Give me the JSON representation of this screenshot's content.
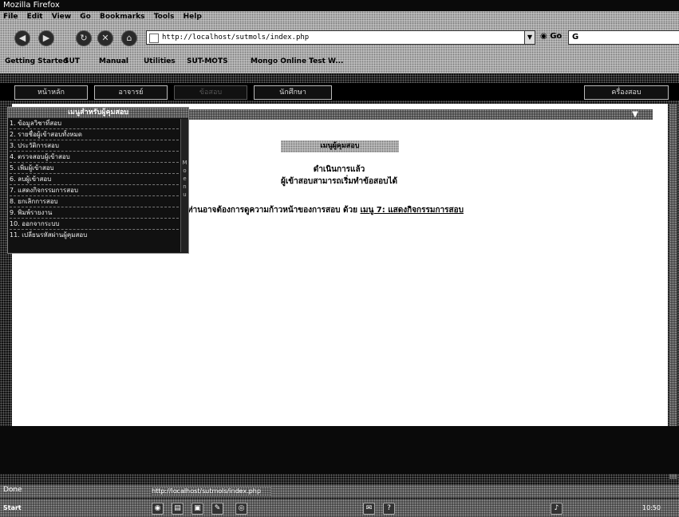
{
  "window": {
    "title": "Mozilla Firefox"
  },
  "menu": [
    "File",
    "Edit",
    "View",
    "Go",
    "Bookmarks",
    "Tools",
    "Help"
  ],
  "toolbar": {
    "url": "http://localhost/sutmols/index.php",
    "go_label": "Go",
    "search_value": "G",
    "back_icon": "back-arrow-icon",
    "forward_icon": "forward-arrow-icon",
    "reload_icon": "reload-icon",
    "stop_icon": "stop-icon",
    "home_icon": "home-icon"
  },
  "bookmarks": [
    "Getting Started",
    "SUT",
    "Manual",
    "Utilities",
    "SUT-MOTS",
    "Mongo Online Test W..."
  ],
  "tabs": [
    "หน้าหลัก",
    "อาจารย์",
    "ข้อสอบ",
    "นักศึกษา",
    "ครื่องสอบ"
  ],
  "dropdown": {
    "header": "เมนูสำหรับผู้คุมสอบ",
    "items": [
      "1. ข้อมูลวิชาที่สอบ",
      "2. รายชื่อผู้เข้าสอบทั้งหมด",
      "3. ประวัติการสอบ",
      "4. ตรวจสอบผู้เข้าสอบ",
      "5. เพิ่มผู้เข้าสอบ",
      "6. ลบผู้เข้าสอบ",
      "7. แสดงกิจกรรมการสอบ",
      "8. ยกเลิกการสอบ",
      "9. พิมพ์รายงาน",
      "10. ออกจากระบบ",
      "11. เปลี่ยนรหัสผ่านผู้คุมสอบ"
    ],
    "scroll_marks": [
      "M",
      "o",
      "e",
      "n",
      "u"
    ]
  },
  "content": {
    "badge": "เมนูผู้คุมสอบ",
    "status_line1": "ดำเนินการแล้ว",
    "status_line2": "ผู้เข้าสอบสามารถเริ่มทำข้อสอบได้",
    "hint_text": "ท่านอาจต้องการดูความก้าวหน้าของการสอบ ด้วย",
    "hint_link": "เมนู 7: แสดงกิจกรรมการสอบ"
  },
  "statusbar": {
    "label": "Done",
    "message": "http://localhost/sutmols/index.php"
  },
  "taskbar": {
    "start": "Start",
    "clock": "10:50"
  }
}
